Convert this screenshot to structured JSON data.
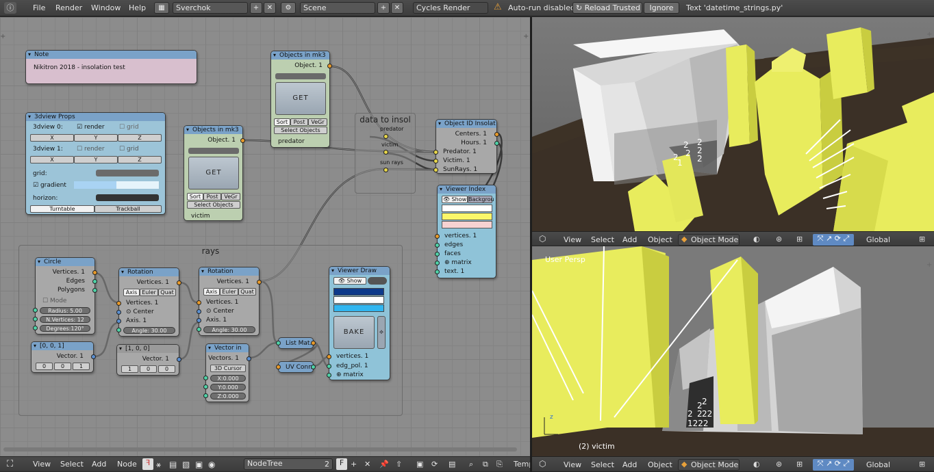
{
  "topbar": {
    "menu": [
      "File",
      "Render",
      "Window",
      "Help"
    ],
    "layout": "Sverchok",
    "scene": "Scene",
    "engine": "Cycles Render",
    "warning": "Auto-run disabled",
    "reload": "Reload Trusted",
    "ignore": "Ignore",
    "text": "Text 'datetime_strings.py'"
  },
  "nodes": {
    "note": {
      "title": "Note",
      "text": "Nikitron 2018 - insolation test"
    },
    "props": {
      "title": "3dview Props",
      "row0": "3dview 0:",
      "row1": "3dview 1:",
      "render": "render",
      "grid": "grid",
      "x": "X",
      "y": "Y",
      "z": "Z",
      "gridlabel": "grid:",
      "gradient": "gradient",
      "horizon": "horizon:",
      "turntable": "Turntable",
      "trackball": "Trackball"
    },
    "obj1": {
      "title": "Objects in mk3",
      "out": "Object. 1",
      "get": "GET",
      "sort": "Sort",
      "post": "Post",
      "vegr": "VeGr",
      "select": "Select Objects",
      "label": "predator"
    },
    "obj2": {
      "title": "Objects in mk3",
      "out": "Object. 1",
      "get": "GET",
      "sort": "Sort",
      "post": "Post",
      "vegr": "VeGr",
      "select": "Select Objects",
      "label": "victim"
    },
    "frame_data": {
      "title": "data to insol",
      "predator": "predator",
      "victim": "victim",
      "sunrays": "sun rays"
    },
    "objid": {
      "title": "Object ID Insolat",
      "centers": "Centers. 1",
      "hours": "Hours. 1",
      "predator": "Predator. 1",
      "victim": "Victim. 1",
      "sunrays": "SunRays. 1"
    },
    "viewerindex": {
      "title": "Viewer Index",
      "show": "Show",
      "background": "Backgrou",
      "vertices": "vertices. 1",
      "edges": "edges",
      "faces": "faces",
      "matrix": "matrix",
      "text": "text. 1"
    },
    "rays": {
      "title": "rays"
    },
    "circle": {
      "title": "Circle",
      "vertices": "Vertices. 1",
      "edges": "Edges",
      "polygons": "Polygons",
      "mode": "Mode",
      "radius": "Radius:   5.00",
      "nverts": "N.Vertices:  12",
      "degrees": "Degrees:120°"
    },
    "vec001": {
      "title": "[0, 0, 1]",
      "out": "Vector. 1",
      "v0": "0",
      "v1": "0",
      "v2": "1"
    },
    "rot1": {
      "title": "Rotation",
      "out": "Vertices. 1",
      "axis": "Axis",
      "euler": "Euler",
      "quat": "Quat",
      "inv": "Vertices. 1",
      "center": "Center",
      "axisin": "Axis. 1",
      "angle": "Angle:   30.00"
    },
    "vec100": {
      "title": "[1, 0, 0]",
      "out": "Vector. 1",
      "v0": "1",
      "v1": "0",
      "v2": "0"
    },
    "rot2": {
      "title": "Rotation",
      "out": "Vertices. 1",
      "axis": "Axis",
      "euler": "Euler",
      "quat": "Quat",
      "inv": "Vertices. 1",
      "center": "Center",
      "axisin": "Axis. 1",
      "angle": "Angle:   30.00"
    },
    "vecin": {
      "title": "Vector in",
      "out": "Vectors. 1",
      "cursor": "3D Cursor",
      "x": "X:0.000",
      "y": "Y:0.000",
      "z": "Z:0.000"
    },
    "listmat": {
      "title": "List Mat."
    },
    "uvconn": {
      "title": "UV Conn"
    },
    "viewerdraw": {
      "title": "Viewer Draw",
      "show": "Show",
      "bake": "BAKE",
      "vertices": "vertices. 1",
      "edgpol": "edg_pol. 1",
      "matrix": "matrix"
    }
  },
  "nodebar": {
    "view": "View",
    "select": "Select",
    "add": "Add",
    "node": "Node",
    "tree": "NodeTree",
    "users": "2",
    "fake": "F",
    "temp": "Temp"
  },
  "viewport_top": {
    "view": "View",
    "select": "Select",
    "add": "Add",
    "object": "Object",
    "mode": "Object Mode",
    "orient": "Global",
    "labels": [
      "2",
      "2",
      "2",
      "2",
      "2",
      "2",
      "1"
    ]
  },
  "viewport_bottom": {
    "persp": "User Persp",
    "objname": "(2) victim",
    "view": "View",
    "select": "Select",
    "add": "Add",
    "object": "Object",
    "mode": "Object Mode",
    "orient": "Global",
    "labels": [
      "2",
      "2",
      "2",
      "2",
      "1222",
      "22"
    ]
  },
  "colors": {
    "accent": "#5b8fd0",
    "yellow": "#eef070",
    "warning": "#e8a13a"
  }
}
